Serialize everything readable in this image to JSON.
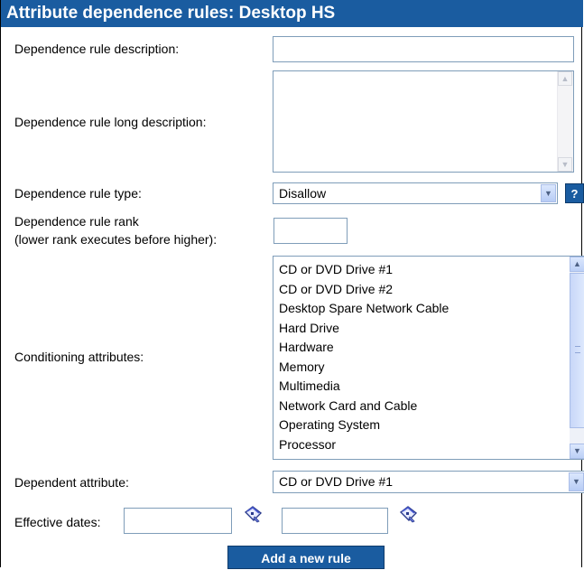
{
  "header": {
    "title": "Attribute dependence rules:  Desktop HS"
  },
  "form": {
    "description_label": "Dependence rule description:",
    "description_value": "",
    "long_description_label": "Dependence rule long description:",
    "long_description_value": "",
    "type_label": "Dependence rule type:",
    "type_value": "Disallow",
    "help_label": "?",
    "rank_label_line1": "Dependence rule rank",
    "rank_label_line2": "(lower rank executes before higher):",
    "rank_value": "",
    "conditioning_label": "Conditioning attributes:",
    "conditioning_options": [
      "CD or DVD Drive #1",
      "CD or DVD Drive #2",
      "Desktop Spare Network Cable",
      "Hard Drive",
      "Hardware",
      "Memory",
      "Multimedia",
      "Network Card and Cable",
      "Operating System",
      "Processor"
    ],
    "dependent_label": "Dependent attribute:",
    "dependent_value": "CD or DVD Drive #1",
    "effective_dates_label": "Effective dates:",
    "start_date_value": "",
    "end_date_value": ""
  },
  "actions": {
    "add_rule_label": "Add a new rule"
  },
  "icons": {
    "calendar": "calendar-icon",
    "scroll_up": "scroll-up-icon",
    "scroll_down": "scroll-down-icon",
    "dropdown": "chevron-down-icon"
  },
  "colors": {
    "header_bg": "#1a5ca0",
    "header_text": "#ffffff",
    "input_border": "#7f9db9"
  }
}
